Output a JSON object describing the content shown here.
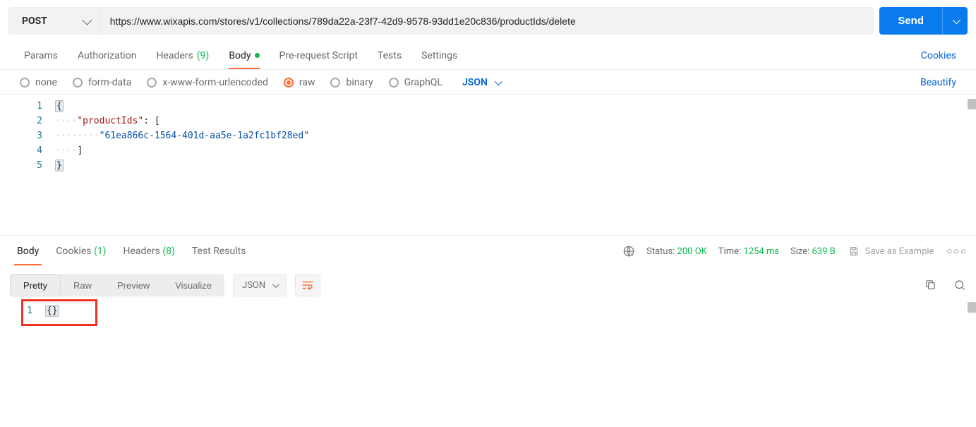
{
  "request": {
    "method": "POST",
    "url": "https://www.wixapis.com/stores/v1/collections/789da22a-23f7-42d9-9578-93dd1e20c836/productIds/delete",
    "send_label": "Send"
  },
  "tabs": {
    "params": "Params",
    "authorization": "Authorization",
    "headers": "Headers",
    "headers_count": "(9)",
    "body": "Body",
    "prerequest": "Pre-request Script",
    "tests": "Tests",
    "settings": "Settings",
    "cookies": "Cookies"
  },
  "bodytypes": {
    "none": "none",
    "formdata": "form-data",
    "xwww": "x-www-form-urlencoded",
    "raw": "raw",
    "binary": "binary",
    "graphql": "GraphQL",
    "format": "JSON",
    "beautify": "Beautify"
  },
  "request_body": {
    "lines": [
      "1",
      "2",
      "3",
      "4",
      "5"
    ],
    "l1": "{",
    "l2_dots": "····",
    "l2_key": "\"productIds\"",
    "l2_rest": ": [",
    "l3_dots": "········",
    "l3_val": "\"61ea866c-1564-401d-aa5e-1a2fc1bf28ed\"",
    "l4_dots": "····",
    "l4": "]",
    "l5": "}"
  },
  "resp_tabs": {
    "body": "Body",
    "cookies": "Cookies",
    "cookies_count": "(1)",
    "headers": "Headers",
    "headers_count": "(8)",
    "test_results": "Test Results"
  },
  "response_meta": {
    "status_label": "Status:",
    "status_value": "200 OK",
    "time_label": "Time:",
    "time_value": "1254 ms",
    "size_label": "Size:",
    "size_value": "639 B",
    "save_example": "Save as Example"
  },
  "resp_view": {
    "pretty": "Pretty",
    "raw": "Raw",
    "preview": "Preview",
    "visualize": "Visualize",
    "format": "JSON"
  },
  "response_body": {
    "gutter1": "1",
    "content": "{}"
  }
}
